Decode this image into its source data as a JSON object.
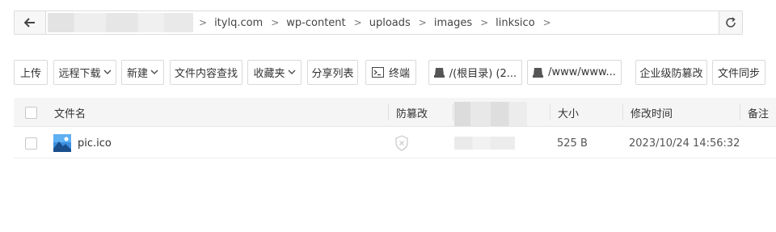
{
  "address": {
    "crumbs": [
      "itylq.com",
      "wp-content",
      "uploads",
      "images",
      "linksico"
    ]
  },
  "toolbar": {
    "upload": "上传",
    "remote_download": "远程下载",
    "new": "新建",
    "content_search": "文件内容查找",
    "favorites": "收藏夹",
    "share_list": "分享列表",
    "terminal": "终端",
    "disk1": "/(根目录) (2...",
    "disk2": "/www/www...",
    "tamper": "企业级防篡改",
    "sync": "文件同步"
  },
  "table": {
    "headers": {
      "name": "文件名",
      "tamper": "防篡改",
      "size": "大小",
      "modified": "修改时间",
      "remark": "备注"
    },
    "rows": [
      {
        "name": "pic.ico",
        "size": "525 B",
        "modified": "2023/10/24 14:56:32"
      }
    ]
  }
}
